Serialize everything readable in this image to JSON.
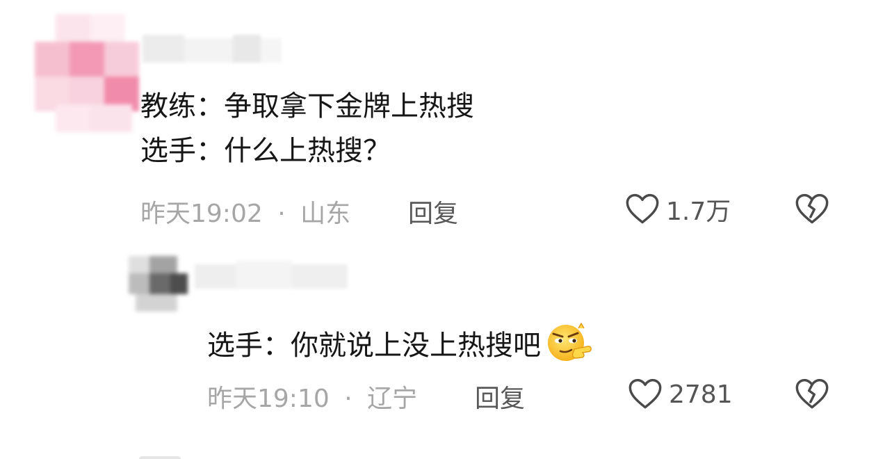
{
  "comments": [
    {
      "lines": [
        "教练：争取拿下金牌上热搜",
        "选手：什么上热搜？"
      ],
      "time": "昨天19:02",
      "separator": "·",
      "location": "山东",
      "reply_label": "回复",
      "likes": "1.7万"
    },
    {
      "lines": [
        "选手：你就说上没上热搜吧"
      ],
      "emoji": "smirk-pointing-emoji",
      "time": "昨天19:10",
      "separator": "·",
      "location": "辽宁",
      "reply_label": "回复",
      "likes": "2781"
    }
  ],
  "icons": {
    "like": "heart-outline-icon",
    "dislike": "broken-heart-icon"
  },
  "colors": {
    "text": "#161616",
    "meta": "#a6a6a6",
    "reply": "#585858",
    "avatar_pink": "#f08aa8"
  }
}
